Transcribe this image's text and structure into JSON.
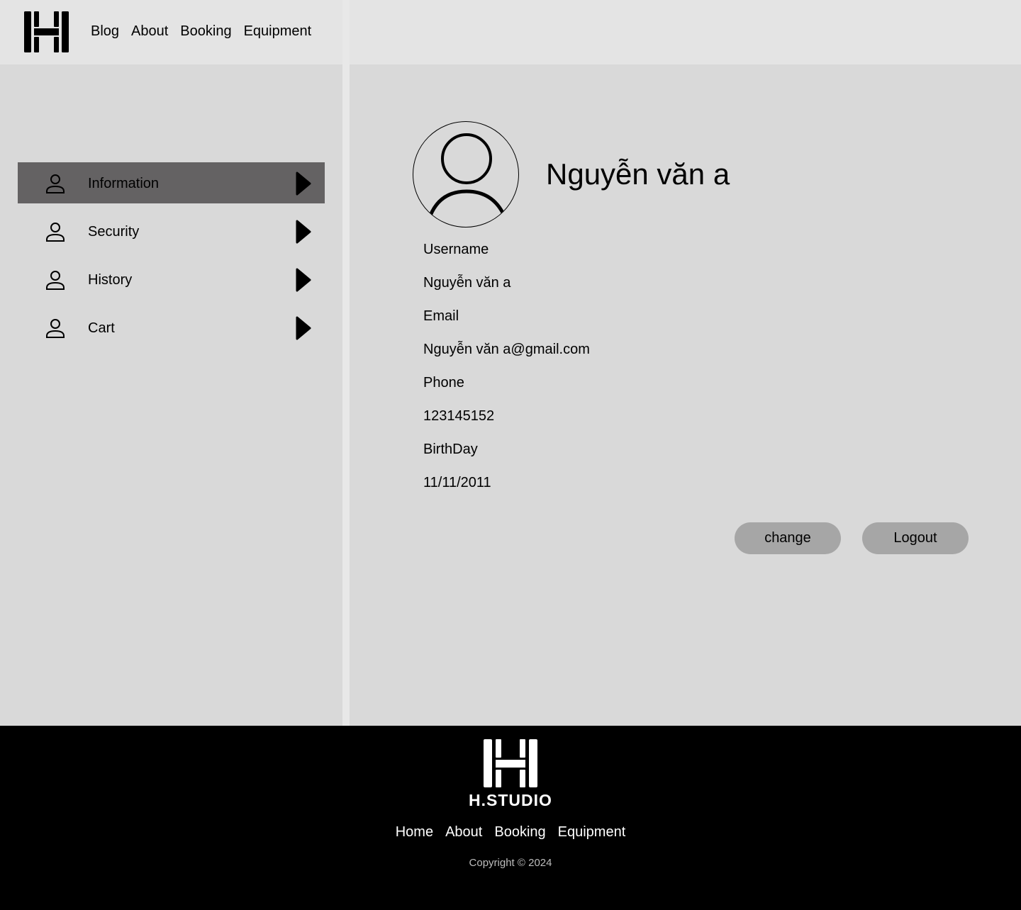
{
  "header": {
    "nav": [
      "Blog",
      "About",
      "Booking",
      "Equipment"
    ]
  },
  "sidebar": {
    "items": [
      {
        "label": "Information",
        "active": true
      },
      {
        "label": "Security",
        "active": false
      },
      {
        "label": "History",
        "active": false
      },
      {
        "label": "Cart",
        "active": false
      }
    ]
  },
  "profile": {
    "name": "Nguyễn văn a",
    "fields": [
      {
        "label": "Username",
        "value": "Nguyễn văn a"
      },
      {
        "label": "Email",
        "value": "Nguyễn văn a@gmail.com"
      },
      {
        "label": "Phone",
        "value": "123145152"
      },
      {
        "label": "BirthDay",
        "value": "11/11/2011"
      }
    ]
  },
  "actions": {
    "change_label": "change",
    "logout_label": "Logout"
  },
  "footer": {
    "brand": "H.STUDIO",
    "nav": [
      "Home",
      "About",
      "Booking",
      "Equipment"
    ],
    "copyright": "Copyright © 2024"
  },
  "colors": {
    "page_bg": "#d9d9d9",
    "header_bg": "#e4e4e4",
    "active_item_bg": "#646263",
    "button_bg": "#a6a6a6",
    "footer_bg": "#000000"
  },
  "icons": [
    "h-logo-icon",
    "user-icon",
    "caret-right-icon",
    "avatar-placeholder-icon"
  ]
}
